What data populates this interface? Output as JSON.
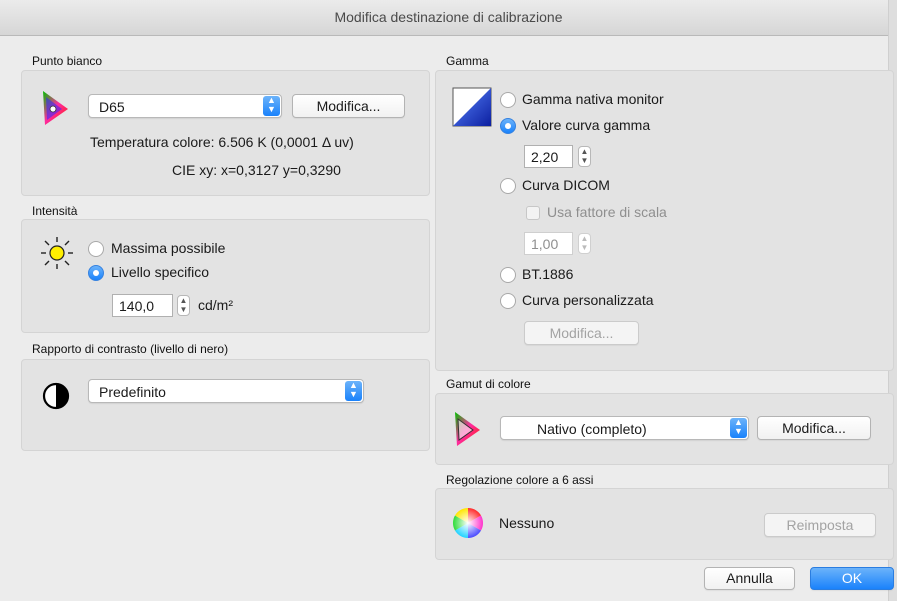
{
  "window": {
    "title": "Modifica destinazione di calibrazione"
  },
  "white_point": {
    "label": "Punto bianco",
    "selected": "D65",
    "edit_button": "Modifica...",
    "color_temp": "Temperatura colore:  6.506 K (0,0001 Δ uv)",
    "cie_xy": "CIE xy:  x=0,3127 y=0,3290"
  },
  "intensity": {
    "label": "Intensità",
    "option_max": "Massima possibile",
    "option_specific": "Livello specifico",
    "value": "140,0",
    "unit": "cd/m²"
  },
  "contrast": {
    "label": "Rapporto di contrasto (livello di nero)",
    "selected": "Predefinito"
  },
  "gamma": {
    "label": "Gamma",
    "option_native": "Gamma nativa monitor",
    "option_curve": "Valore curva gamma",
    "curve_value": "2,20",
    "option_dicom": "Curva DICOM",
    "scale_checkbox": "Usa fattore di scala",
    "scale_value": "1,00",
    "option_bt1886": "BT.1886",
    "option_custom": "Curva personalizzata",
    "edit_button": "Modifica..."
  },
  "gamut": {
    "label": "Gamut di colore",
    "selected": "Nativo (completo)",
    "edit_button": "Modifica..."
  },
  "six_axis": {
    "label": "Regolazione colore a 6 assi",
    "value": "Nessuno",
    "reset_button": "Reimposta"
  },
  "footer": {
    "cancel": "Annulla",
    "ok": "OK"
  },
  "colors": {
    "accent": "#1a82fb"
  }
}
